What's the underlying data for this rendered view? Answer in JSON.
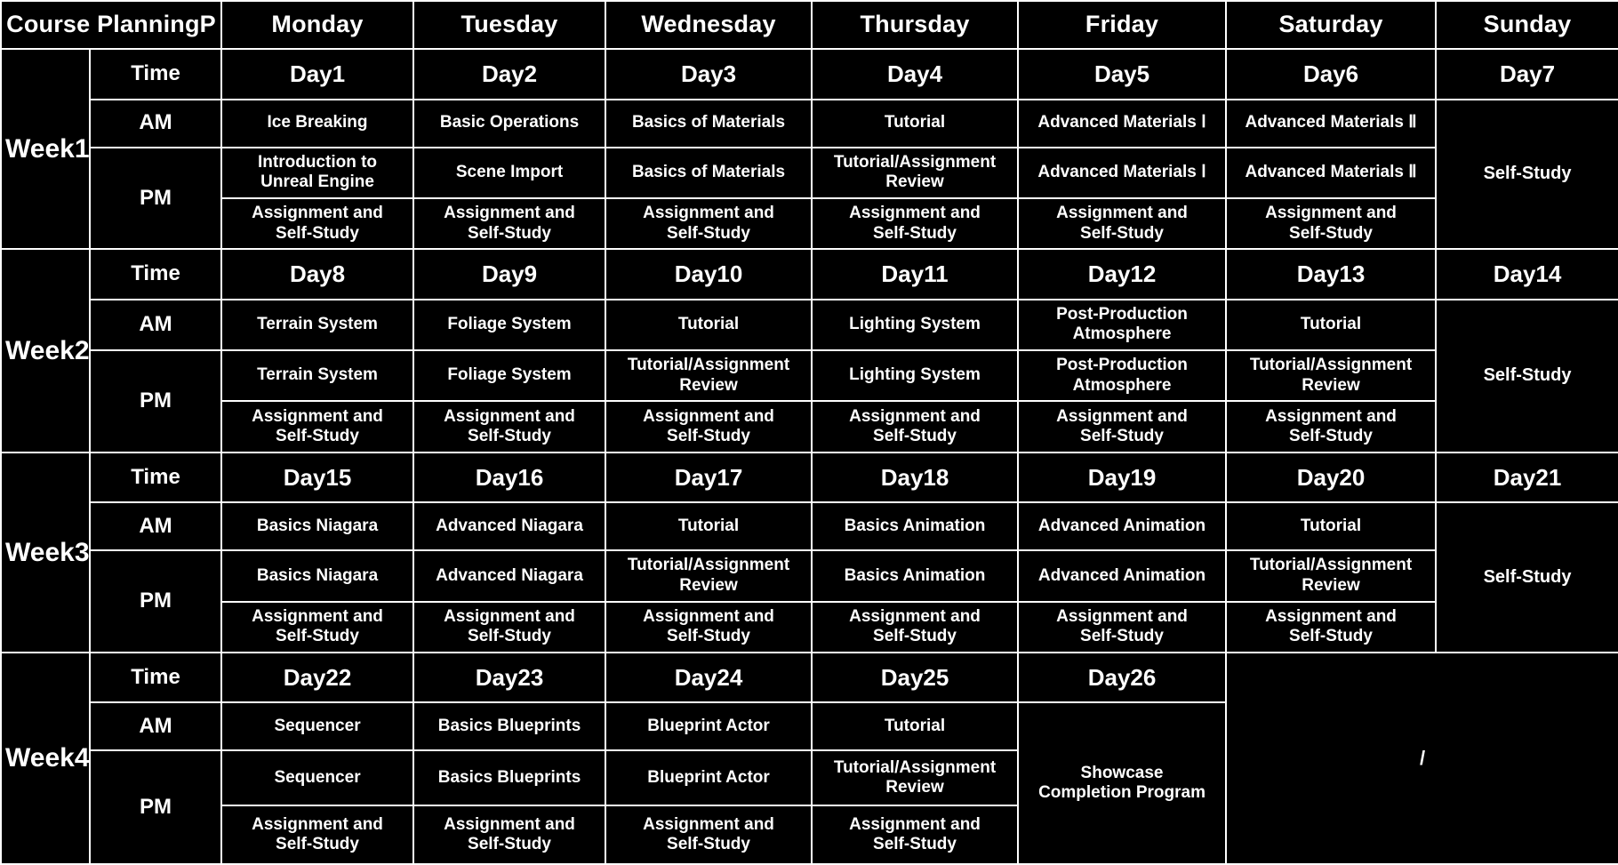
{
  "title": "Course PlanningP",
  "colors": {
    "header_left": "#9a6296",
    "header_right": "#f6a886",
    "week_top": "#f5a084",
    "week_bottom": "#9a6aa8",
    "cell_bg": "#000000",
    "text": "#ffffff",
    "grid": "#ffffff"
  },
  "header": {
    "title": "Course PlanningP",
    "days": [
      "Monday",
      "Tuesday",
      "Wednesday",
      "Thursday",
      "Friday",
      "Saturday",
      "Sunday"
    ]
  },
  "labels": {
    "time": "Time",
    "am": "AM",
    "pm": "PM",
    "self_study": "Self-Study",
    "assignment_self_study": "Assignment and\nSelf-Study",
    "slash": "/"
  },
  "weeks": [
    {
      "name": "Week1",
      "time_label": "Time",
      "days": [
        "Day1",
        "Day2",
        "Day3",
        "Day4",
        "Day5",
        "Day6",
        "Day7"
      ],
      "am_label": "AM",
      "pm_label": "PM",
      "am": [
        "Ice Breaking",
        "Basic Operations",
        "Basics of Materials",
        "Tutorial",
        "Advanced Materials Ⅰ",
        "Advanced Materials Ⅱ"
      ],
      "pm": [
        "Introduction to\nUnreal Engine",
        "Scene Import",
        "Basics of Materials",
        "Tutorial/Assignment\nReview",
        "Advanced Materials Ⅰ",
        "Advanced Materials Ⅱ"
      ],
      "evening": [
        "Assignment and\nSelf-Study",
        "Assignment and\nSelf-Study",
        "Assignment and\nSelf-Study",
        "Assignment and\nSelf-Study",
        "Assignment and\nSelf-Study",
        "Assignment and\nSelf-Study"
      ],
      "sunday": "Self-Study"
    },
    {
      "name": "Week2",
      "time_label": "Time",
      "days": [
        "Day8",
        "Day9",
        "Day10",
        "Day11",
        "Day12",
        "Day13",
        "Day14"
      ],
      "am_label": "AM",
      "pm_label": "PM",
      "am": [
        "Terrain System",
        "Foliage System",
        "Tutorial",
        "Lighting System",
        "Post-Production\nAtmosphere",
        "Tutorial"
      ],
      "pm": [
        "Terrain System",
        "Foliage System",
        "Tutorial/Assignment\nReview",
        "Lighting System",
        "Post-Production\nAtmosphere",
        "Tutorial/Assignment\nReview"
      ],
      "evening": [
        "Assignment and\nSelf-Study",
        "Assignment and\nSelf-Study",
        "Assignment and\nSelf-Study",
        "Assignment and\nSelf-Study",
        "Assignment and\nSelf-Study",
        "Assignment and\nSelf-Study"
      ],
      "sunday": "Self-Study"
    },
    {
      "name": "Week3",
      "time_label": "Time",
      "days": [
        "Day15",
        "Day16",
        "Day17",
        "Day18",
        "Day19",
        "Day20",
        "Day21"
      ],
      "am_label": "AM",
      "pm_label": "PM",
      "am": [
        "Basics Niagara",
        "Advanced Niagara",
        "Tutorial",
        "Basics Animation",
        "Advanced Animation",
        "Tutorial"
      ],
      "pm": [
        "Basics Niagara",
        "Advanced Niagara",
        "Tutorial/Assignment\nReview",
        "Basics Animation",
        "Advanced Animation",
        "Tutorial/Assignment\nReview"
      ],
      "evening": [
        "Assignment and\nSelf-Study",
        "Assignment and\nSelf-Study",
        "Assignment and\nSelf-Study",
        "Assignment and\nSelf-Study",
        "Assignment and\nSelf-Study",
        "Assignment and\nSelf-Study"
      ],
      "sunday": "Self-Study"
    },
    {
      "name": "Week4",
      "time_label": "Time",
      "days": [
        "Day22",
        "Day23",
        "Day24",
        "Day25",
        "Day26"
      ],
      "am_label": "AM",
      "pm_label": "PM",
      "am": [
        "Sequencer",
        "Basics Blueprints",
        "Blueprint Actor",
        "Tutorial"
      ],
      "pm": [
        "Sequencer",
        "Basics Blueprints",
        "Blueprint Actor",
        "Tutorial/Assignment\nReview"
      ],
      "evening": [
        "Assignment and\nSelf-Study",
        "Assignment and\nSelf-Study",
        "Assignment and\nSelf-Study",
        "Assignment and\nSelf-Study"
      ],
      "friday_merged": "Showcase\nCompletion Program",
      "weekend_merged": "/"
    }
  ]
}
